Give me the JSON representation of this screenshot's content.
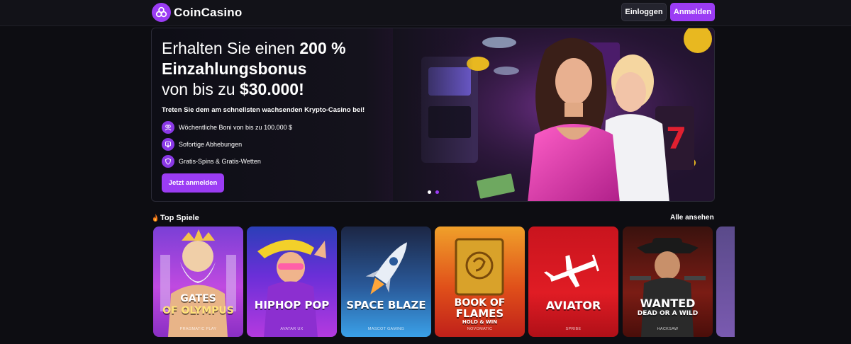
{
  "header": {
    "brand": "CoinCasino",
    "login_label": "Einloggen",
    "register_label": "Anmelden",
    "accent_color": "#9b3cf4"
  },
  "hero": {
    "line1_pre": "Erhalten Sie einen ",
    "line1_bold": "200 %",
    "line2_bold": "Einzahlungsbonus",
    "line3_pre": "von bis zu ",
    "line3_bold": "$30.000!",
    "subtitle": "Treten Sie dem am schnellsten wachsenden Krypto-Casino bei!",
    "features": [
      {
        "icon": "people-icon",
        "text": "Wöchentliche Boni von bis zu 100.000 $"
      },
      {
        "icon": "withdraw-icon",
        "text": "Sofortige Abhebungen"
      },
      {
        "icon": "shield-icon",
        "text": "Gratis-Spins & Gratis-Wetten"
      }
    ],
    "cta_label": "Jetzt anmelden",
    "slide_count": 2,
    "active_slide": 2
  },
  "top_games": {
    "title": "Top Spiele",
    "title_icon": "fire-icon",
    "see_all_label": "Alle ansehen",
    "games": [
      {
        "title_line1": "GATES",
        "title_line2": "OF OLYMPUS",
        "provider": "PRAGMATIC PLAY"
      },
      {
        "title_line1": "HIPHOP POP",
        "title_line2": "",
        "provider": "AVATAR UX"
      },
      {
        "title_line1": "SPACE BLAZE",
        "title_line2": "",
        "provider": "MASCOT GAMING"
      },
      {
        "title_line1": "BOOK OF",
        "title_line2": "FLAMES",
        "title_line3": "HOLD & WIN",
        "provider": "NOVOMATIC"
      },
      {
        "title_line1": "AVIATOR",
        "title_line2": "",
        "provider": "SPRIBE"
      },
      {
        "title_line1": "WANTED",
        "title_line2": "DEAD OR A WILD",
        "provider": "HACKSAW"
      }
    ]
  }
}
